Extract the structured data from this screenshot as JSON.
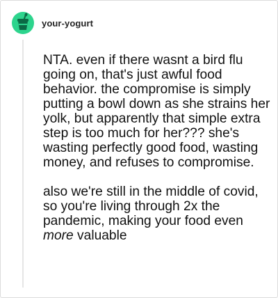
{
  "post": {
    "username": "your-yogurt",
    "avatar_icon": "yogurt-avatar-icon",
    "accent_color": "#2dd48d",
    "paragraph1": "NTA. even if there wasnt a bird flu going on, that's just awful food behavior. the compromise is simply putting a bowl down as she strains her yolk, but apparently that simple extra step is too much for her??? she's wasting perfectly good food, wasting money, and refuses to compromise.",
    "paragraph2_before": "also we're still in the middle of covid, so you're living through 2x the pandemic, making your food even ",
    "paragraph2_emphasis": "more",
    "paragraph2_after": " valuable"
  }
}
